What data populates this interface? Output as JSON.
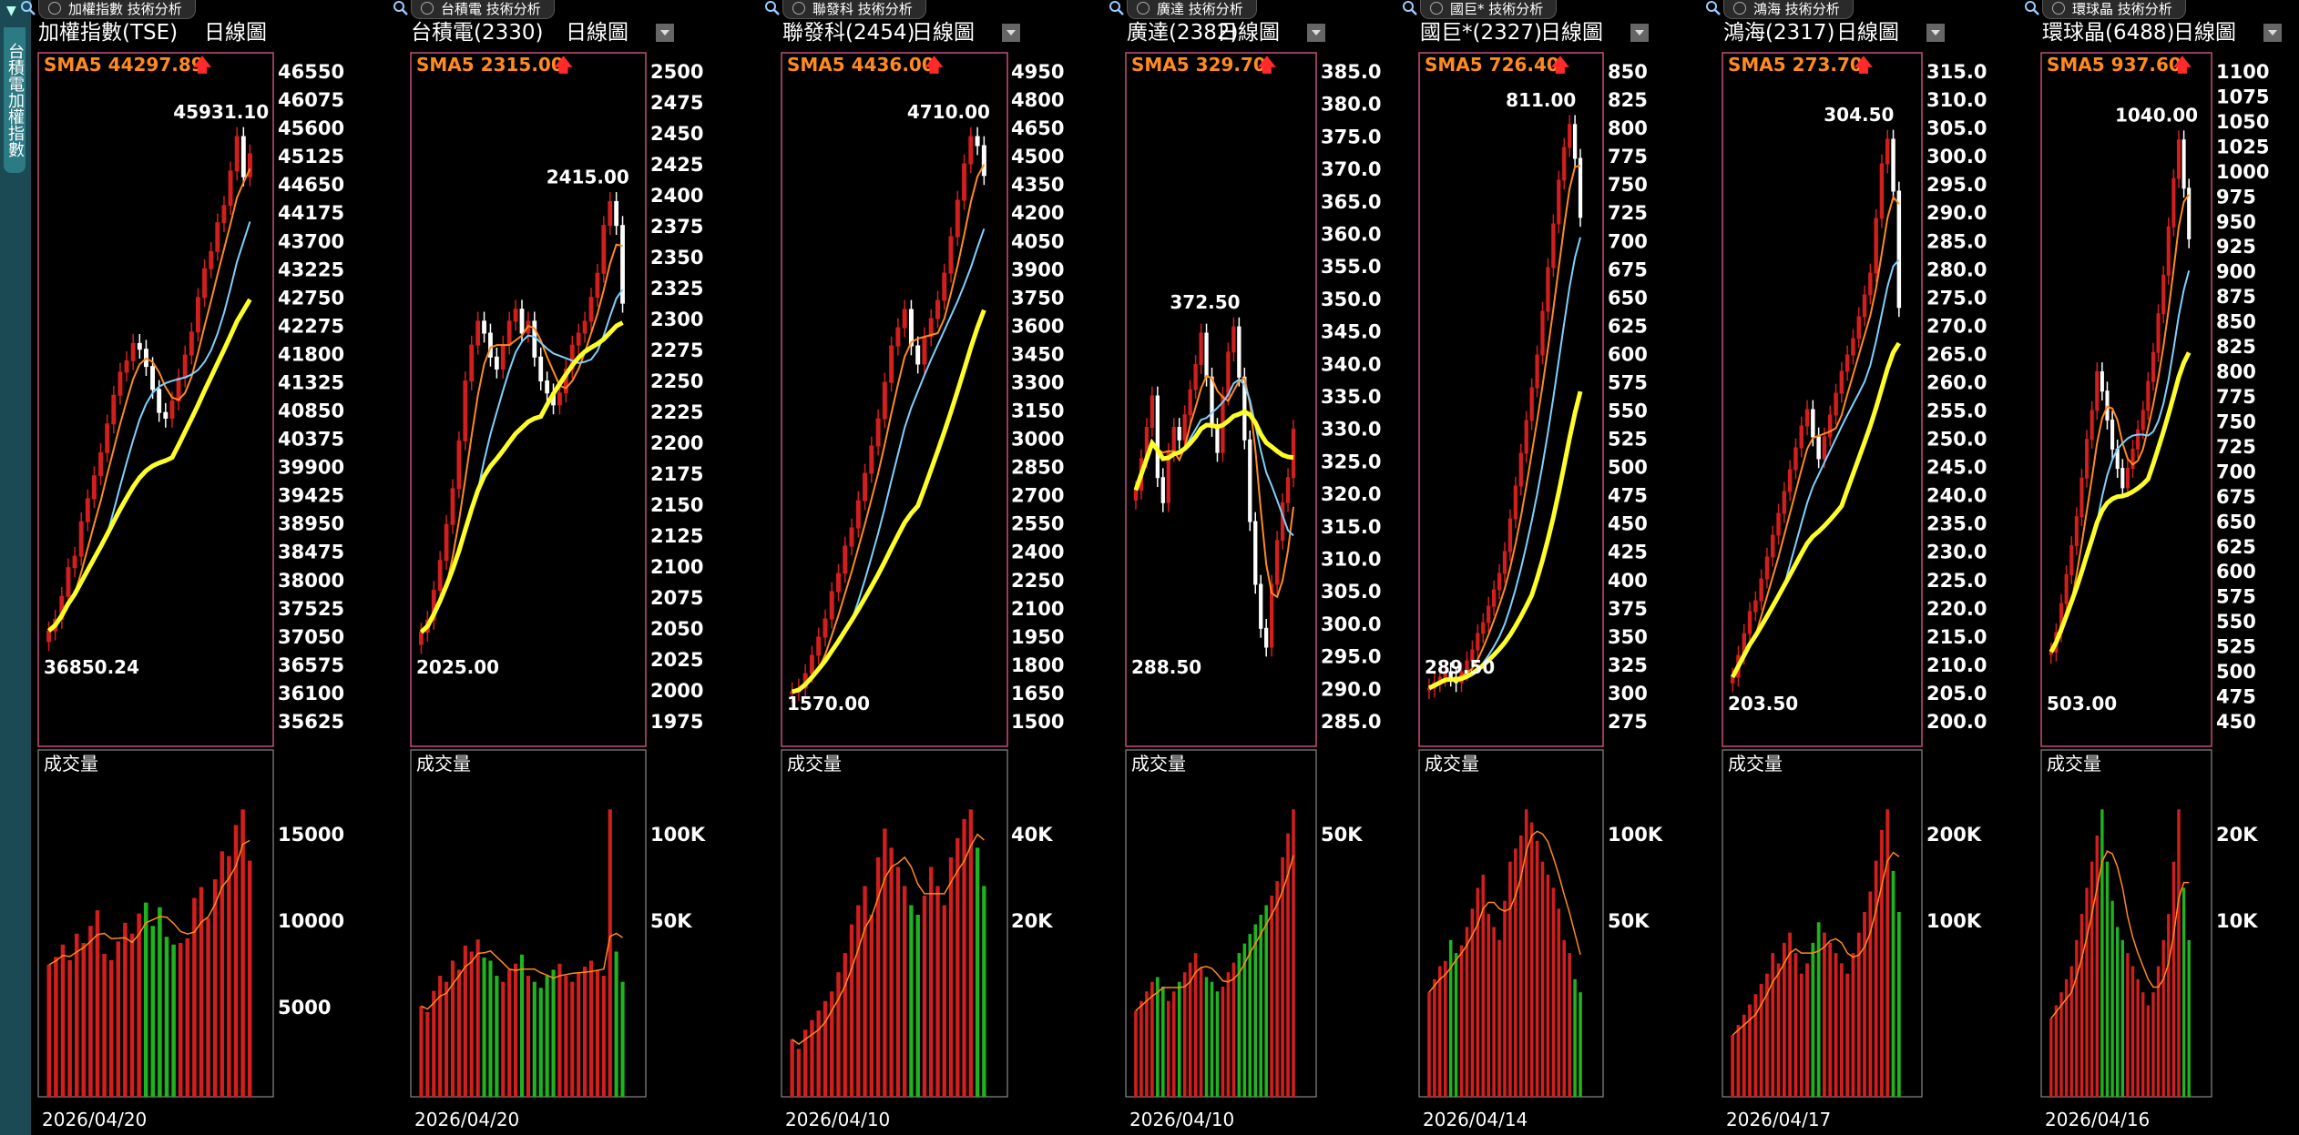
{
  "sidebar": {
    "tab_text": "台積電加權指數"
  },
  "colors": {
    "up": "#d31e1e",
    "down": "#1fb31f",
    "sma_label": "#ff8a1e",
    "sma5": "#ff8a1e",
    "sma10": "#7fd0ff",
    "sma20": "#ffff28",
    "vol_label": "#fff",
    "frame": "#c2507f"
  },
  "panels": [
    {
      "tab": "加權指數 技術分析",
      "title": "加權指數(TSE)",
      "daily": "日線圖",
      "sma": "SMA5 44297.89",
      "date": "2026/04/20",
      "vol_label": "成交量",
      "high_label": "45931.10",
      "low_label": "36850.24",
      "y_ticks": [
        "46550",
        "46075",
        "45600",
        "45125",
        "44650",
        "44175",
        "43700",
        "43225",
        "42750",
        "42275",
        "41800",
        "41325",
        "40850",
        "40375",
        "39900",
        "39425",
        "38950",
        "38475",
        "38000",
        "37525",
        "37050",
        "36575",
        "36100",
        "35625"
      ],
      "vol_ticks": [
        "15000",
        "10000",
        "5000"
      ]
    },
    {
      "tab": "台積電 技術分析",
      "title": "台積電(2330)",
      "daily": "日線圖",
      "sma": "SMA5 2315.00",
      "date": "2026/04/20",
      "vol_label": "成交量",
      "high_label": "2415.00",
      "low_label": "2025.00",
      "y_ticks": [
        "2500",
        "2475",
        "2450",
        "2425",
        "2400",
        "2375",
        "2350",
        "2325",
        "2300",
        "2275",
        "2250",
        "2225",
        "2200",
        "2175",
        "2150",
        "2125",
        "2100",
        "2075",
        "2050",
        "2025",
        "2000",
        "1975"
      ],
      "vol_ticks": [
        "100K",
        "50K"
      ]
    },
    {
      "tab": "聯發科 技術分析",
      "title": "聯發科(2454)",
      "daily": "日線圖",
      "sma": "SMA5 4436.00",
      "date": "2026/04/10",
      "vol_label": "成交量",
      "high_label": "4710.00",
      "low_label": "1570.00",
      "y_ticks": [
        "4950",
        "4800",
        "4650",
        "4500",
        "4350",
        "4200",
        "4050",
        "3900",
        "3750",
        "3600",
        "3450",
        "3300",
        "3150",
        "3000",
        "2850",
        "2700",
        "2550",
        "2400",
        "2250",
        "2100",
        "1950",
        "1800",
        "1650",
        "1500"
      ],
      "vol_ticks": [
        "40K",
        "20K"
      ]
    },
    {
      "tab": "廣達 技術分析",
      "title": "廣達(2382)",
      "daily": "日線圖",
      "sma": "SMA5 329.70",
      "date": "2026/04/10",
      "vol_label": "成交量",
      "high_label": "372.50",
      "low_label": "288.50",
      "y_ticks": [
        "385.0",
        "380.0",
        "375.0",
        "370.0",
        "365.0",
        "360.0",
        "355.0",
        "350.0",
        "345.0",
        "340.0",
        "335.0",
        "330.0",
        "325.0",
        "320.0",
        "315.0",
        "310.0",
        "305.0",
        "300.0",
        "295.0",
        "290.0",
        "285.0"
      ],
      "vol_ticks": [
        "50K"
      ]
    },
    {
      "tab": "國巨* 技術分析",
      "title": "國巨*(2327)",
      "daily": "日線圖",
      "sma": "SMA5 726.40",
      "date": "2026/04/14",
      "vol_label": "成交量",
      "high_label": "811.00",
      "low_label": "289.50",
      "y_ticks": [
        "850",
        "825",
        "800",
        "775",
        "750",
        "725",
        "700",
        "675",
        "650",
        "625",
        "600",
        "575",
        "550",
        "525",
        "500",
        "475",
        "450",
        "425",
        "400",
        "375",
        "350",
        "325",
        "300",
        "275"
      ],
      "vol_ticks": [
        "100K",
        "50K"
      ]
    },
    {
      "tab": "鴻海 技術分析",
      "title": "鴻海(2317)",
      "daily": "日線圖",
      "sma": "SMA5 273.70",
      "date": "2026/04/17",
      "vol_label": "成交量",
      "high_label": "304.50",
      "low_label": "203.50",
      "y_ticks": [
        "315.0",
        "310.0",
        "305.0",
        "300.0",
        "295.0",
        "290.0",
        "285.0",
        "280.0",
        "275.0",
        "270.0",
        "265.0",
        "260.0",
        "255.0",
        "250.0",
        "245.0",
        "240.0",
        "235.0",
        "230.0",
        "225.0",
        "220.0",
        "215.0",
        "210.0",
        "205.0",
        "200.0"
      ],
      "vol_ticks": [
        "200K",
        "100K"
      ]
    },
    {
      "tab": "環球晶 技術分析",
      "title": "環球晶(6488)",
      "daily": "日線圖",
      "sma": "SMA5 937.60",
      "date": "2026/04/16",
      "vol_label": "成交量",
      "high_label": "1040.00",
      "low_label": "503.00",
      "y_ticks": [
        "1100",
        "1075",
        "1050",
        "1025",
        "1000",
        "975",
        "950",
        "925",
        "900",
        "875",
        "850",
        "825",
        "800",
        "775",
        "750",
        "725",
        "700",
        "675",
        "650",
        "625",
        "600",
        "575",
        "550",
        "525",
        "500",
        "475",
        "450"
      ],
      "vol_ticks": [
        "20K",
        "10K"
      ]
    }
  ],
  "chart_data": [
    {
      "type": "candlestick",
      "title": "加權指數(TSE)",
      "ylim": [
        35625,
        46550
      ],
      "volume_ticks": [
        15000,
        10000,
        5000
      ],
      "closes": [
        37000,
        37200,
        37600,
        38100,
        38300,
        38900,
        39300,
        39700,
        40100,
        40600,
        41100,
        41500,
        41700,
        42000,
        41900,
        41600,
        41200,
        40800,
        40700,
        41000,
        41400,
        41800,
        42200,
        42800,
        43300,
        43600,
        44100,
        44400,
        45000,
        45600,
        44900,
        45300
      ],
      "volumes": [
        8500,
        9000,
        9800,
        8800,
        10500,
        9900,
        11000,
        12000,
        9200,
        8800,
        10000,
        11200,
        10500,
        11800,
        12500,
        11000,
        12200,
        10300,
        9800,
        9900,
        10200,
        12800,
        13500,
        11500,
        14000,
        15800,
        15500,
        17500,
        18500,
        15200
      ]
    },
    {
      "type": "candlestick",
      "title": "台積電(2330)",
      "ylim": [
        1975,
        2500
      ],
      "volume_ticks": [
        "100K",
        "50K"
      ],
      "closes": [
        2040,
        2050,
        2075,
        2100,
        2130,
        2160,
        2200,
        2250,
        2280,
        2300,
        2290,
        2270,
        2260,
        2280,
        2300,
        2310,
        2290,
        2300,
        2270,
        2250,
        2240,
        2230,
        2240,
        2260,
        2280,
        2290,
        2300,
        2320,
        2340,
        2380,
        2400,
        2380,
        2315
      ],
      "volumes": [
        30,
        28,
        35,
        40,
        38,
        45,
        42,
        50,
        48,
        52,
        46,
        45,
        40,
        38,
        42,
        44,
        47,
        40,
        38,
        36,
        40,
        42,
        44,
        40,
        38,
        41,
        43,
        45,
        42,
        40,
        95,
        48,
        38
      ]
    },
    {
      "type": "candlestick",
      "title": "聯發科(2454)",
      "ylim": [
        1500,
        4950
      ],
      "volume_ticks": [
        "40K",
        "20K"
      ],
      "closes": [
        1600,
        1620,
        1700,
        1800,
        1900,
        2000,
        2150,
        2250,
        2400,
        2500,
        2650,
        2800,
        2950,
        3100,
        3300,
        3500,
        3600,
        3700,
        3500,
        3400,
        3550,
        3650,
        3750,
        3900,
        4100,
        4300,
        4500,
        4650,
        4600,
        4436
      ],
      "volumes": [
        6,
        5,
        7,
        8,
        9,
        10,
        11,
        13,
        15,
        18,
        20,
        22,
        19,
        25,
        28,
        26,
        24,
        22,
        20,
        19,
        21,
        24,
        22,
        20,
        25,
        27,
        29,
        30,
        26,
        22
      ]
    },
    {
      "type": "candlestick",
      "title": "廣達(2382)",
      "ylim": [
        285,
        385
      ],
      "volume_ticks": [
        "50K"
      ],
      "closes": [
        320,
        325,
        330,
        335,
        322,
        318,
        326,
        330,
        328,
        332,
        336,
        340,
        345,
        338,
        330,
        326,
        335,
        342,
        346,
        338,
        328,
        315,
        305,
        298,
        295,
        305,
        312,
        318,
        322,
        329.7
      ],
      "volumes": [
        18,
        20,
        22,
        24,
        25,
        23,
        20,
        22,
        24,
        26,
        28,
        30,
        27,
        25,
        24,
        22,
        23,
        26,
        28,
        30,
        32,
        34,
        36,
        38,
        40,
        42,
        45,
        50,
        55,
        60
      ]
    },
    {
      "type": "candlestick",
      "title": "國巨*(2327)",
      "ylim": [
        275,
        850
      ],
      "volume_ticks": [
        "100K",
        "50K"
      ],
      "closes": [
        295,
        300,
        305,
        310,
        305,
        300,
        310,
        320,
        330,
        345,
        355,
        370,
        385,
        400,
        420,
        450,
        480,
        510,
        540,
        570,
        600,
        640,
        680,
        720,
        760,
        790,
        811,
        780,
        726
      ],
      "volumes": [
        40,
        45,
        50,
        52,
        60,
        55,
        58,
        65,
        72,
        80,
        85,
        70,
        65,
        60,
        75,
        90,
        95,
        100,
        110,
        105,
        98,
        90,
        85,
        80,
        72,
        60,
        55,
        45,
        40
      ]
    },
    {
      "type": "candlestick",
      "title": "鴻海(2317)",
      "ylim": [
        200,
        315
      ],
      "volume_ticks": [
        "200K",
        "100K"
      ],
      "closes": [
        206,
        210,
        214,
        218,
        220,
        224,
        228,
        232,
        236,
        240,
        244,
        248,
        252,
        255,
        250,
        246,
        250,
        254,
        258,
        262,
        265,
        268,
        272,
        276,
        280,
        290,
        300,
        304.5,
        295,
        273.7
      ],
      "volumes": [
        60,
        70,
        80,
        90,
        100,
        110,
        120,
        140,
        130,
        150,
        160,
        140,
        120,
        130,
        150,
        170,
        160,
        150,
        140,
        130,
        120,
        140,
        160,
        180,
        200,
        230,
        260,
        280,
        220,
        180
      ]
    },
    {
      "type": "candlestick",
      "title": "環球晶(6488)",
      "ylim": [
        450,
        1100
      ],
      "volume_ticks": [
        "20K",
        "10K"
      ],
      "closes": [
        510,
        530,
        560,
        590,
        620,
        650,
        690,
        730,
        760,
        800,
        780,
        750,
        720,
        700,
        680,
        700,
        720,
        740,
        760,
        790,
        820,
        860,
        900,
        950,
        1000,
        1040,
        990,
        937.6
      ],
      "volumes": [
        6,
        7,
        8,
        9,
        10,
        12,
        14,
        16,
        18,
        20,
        22,
        18,
        15,
        13,
        12,
        11,
        10,
        9,
        8,
        7,
        8,
        10,
        12,
        14,
        18,
        22,
        16,
        12
      ]
    }
  ]
}
